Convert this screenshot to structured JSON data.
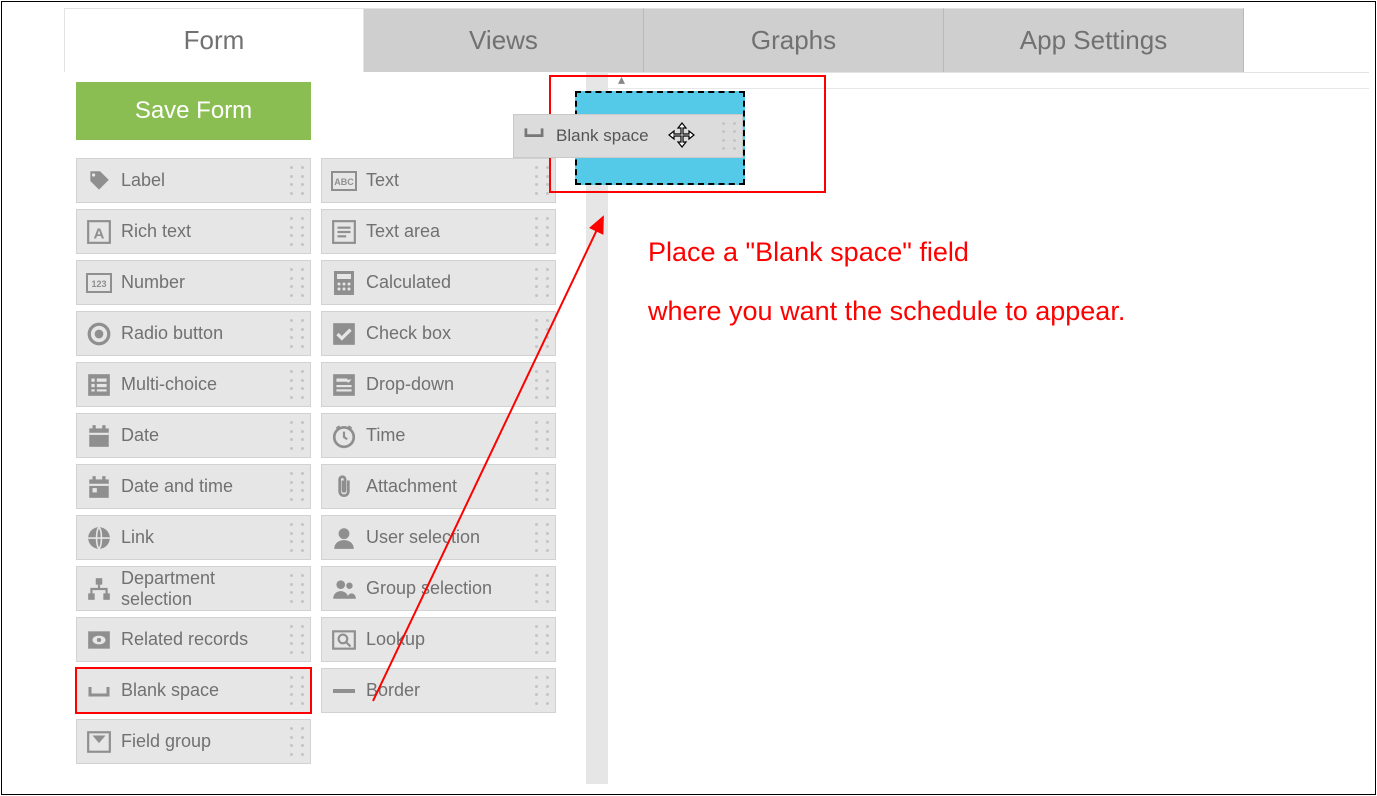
{
  "tabs": {
    "form": "Form",
    "views": "Views",
    "graphs": "Graphs",
    "settings": "App Settings"
  },
  "buttons": {
    "save": "Save Form"
  },
  "fields": {
    "label": "Label",
    "text": "Text",
    "richtext": "Rich text",
    "textarea": "Text area",
    "number": "Number",
    "calculated": "Calculated",
    "radio": "Radio button",
    "checkbox": "Check box",
    "multichoice": "Multi-choice",
    "dropdown": "Drop-down",
    "date": "Date",
    "time": "Time",
    "datetime": "Date and time",
    "attachment": "Attachment",
    "link": "Link",
    "userselection": "User selection",
    "department": "Department selection",
    "groupselection": "Group selection",
    "related": "Related records",
    "lookup": "Lookup",
    "blankspace": "Blank space",
    "border": "Border",
    "fieldgroup": "Field group"
  },
  "dragging": {
    "label": "Blank space"
  },
  "instruction": {
    "line1": "Place a \"Blank space\" field",
    "line2": "where you want the schedule to appear."
  }
}
